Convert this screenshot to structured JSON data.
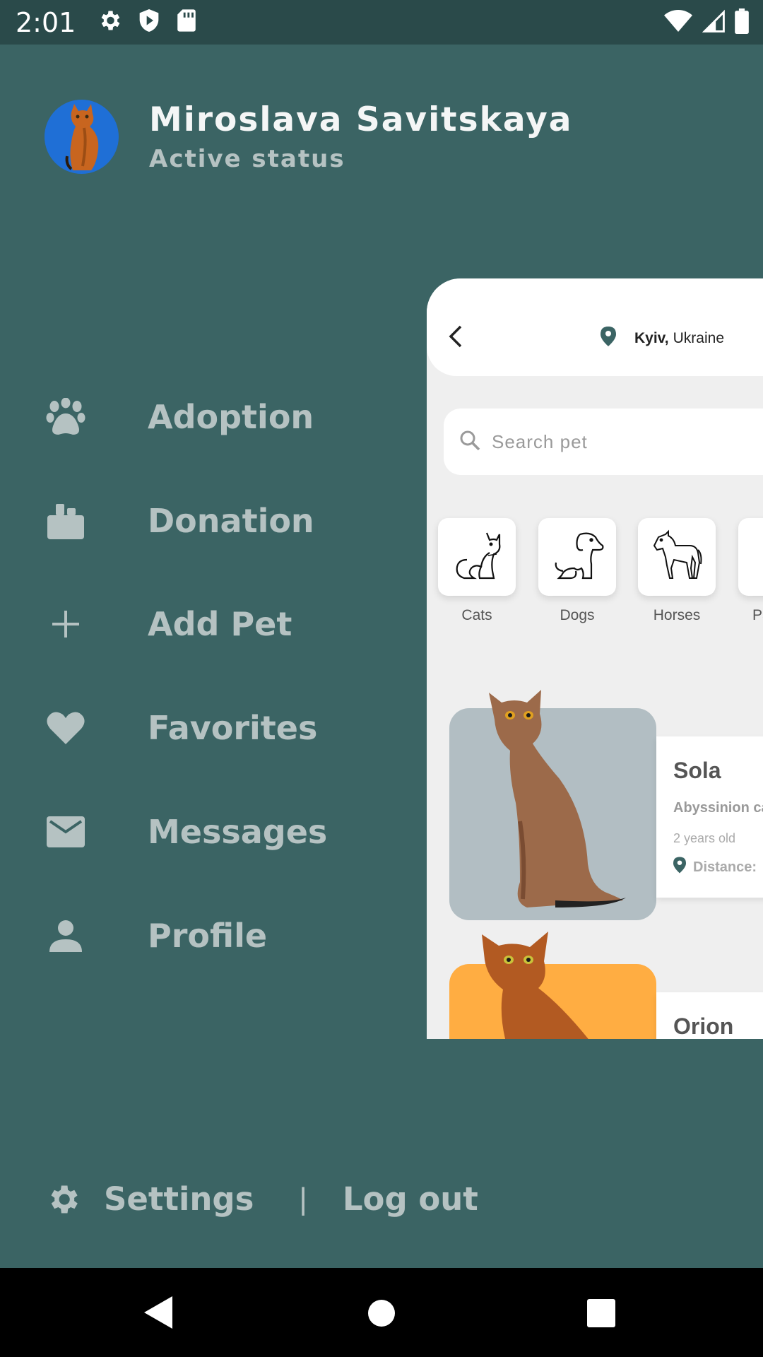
{
  "status_bar": {
    "time": "2:01"
  },
  "drawer": {
    "profile": {
      "name": "Miroslava Savitskaya",
      "status": "Active status"
    },
    "menu": [
      {
        "label": "Adoption",
        "icon": "paw-icon"
      },
      {
        "label": "Donation",
        "icon": "briefcase-icon"
      },
      {
        "label": "Add Pet",
        "icon": "plus-icon"
      },
      {
        "label": "Favorites",
        "icon": "heart-icon"
      },
      {
        "label": "Messages",
        "icon": "mail-icon"
      },
      {
        "label": "Profile",
        "icon": "person-icon"
      }
    ],
    "footer": {
      "settings_label": "Settings",
      "separator": "|",
      "logout_label": "Log out"
    }
  },
  "app_panel": {
    "location": {
      "city": "Kyiv,",
      "country": "Ukraine"
    },
    "search": {
      "placeholder": "Search pet"
    },
    "categories": [
      {
        "label": "Cats",
        "icon": "cat-icon"
      },
      {
        "label": "Dogs",
        "icon": "dog-icon"
      },
      {
        "label": "Horses",
        "icon": "horse-icon"
      },
      {
        "label": "Pa",
        "icon": "parrot-icon"
      }
    ],
    "pets": [
      {
        "name": "Sola",
        "breed": "Abyssinion ca",
        "age": "2 years old",
        "distance": "Distance:",
        "photo_bg": "#b2bec3"
      },
      {
        "name": "Orion",
        "photo_bg": "#ffad42"
      }
    ]
  },
  "colors": {
    "drawer_bg": "#3b6464",
    "status_bar_bg": "#2a4a4a",
    "accent": "#3b6464",
    "muted_text": "#b5c2c2"
  }
}
